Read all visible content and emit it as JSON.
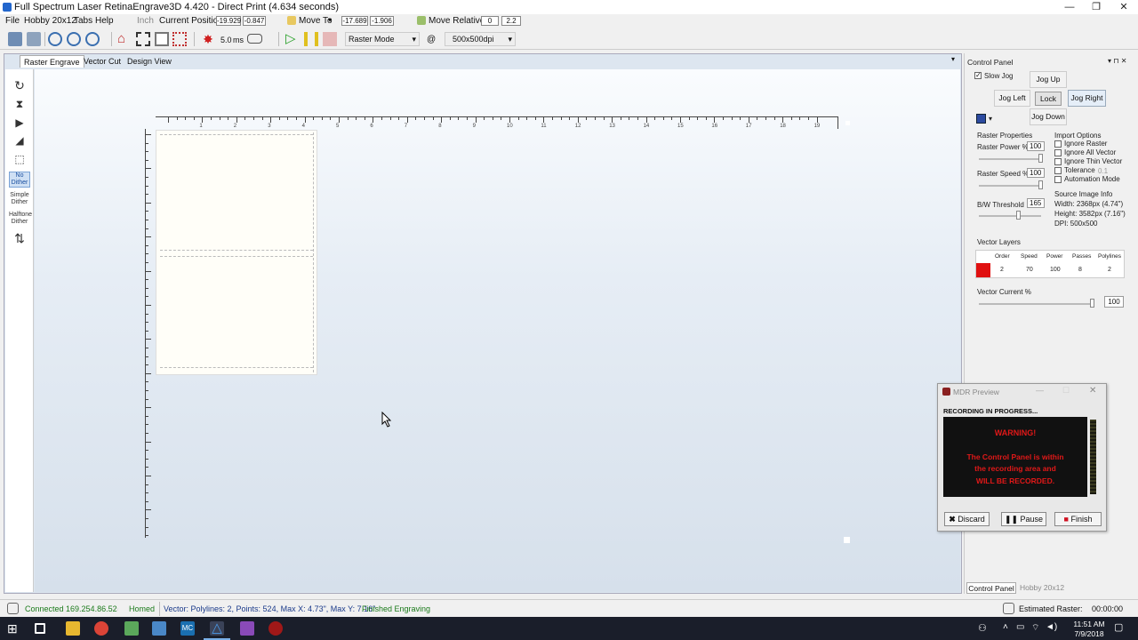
{
  "window": {
    "title": "Full Spectrum Laser RetinaEngrave3D 4.420 - Direct Print (4.634 seconds)"
  },
  "menu": {
    "items": [
      "File",
      "Hobby 20x12",
      "Tabs",
      "Help"
    ],
    "units": "Inch",
    "current_position_label": "Current Position:",
    "pos_x": "-19.929",
    "pos_y": "-0.847",
    "move_to_label": "Move To",
    "move_x": "-17.689",
    "move_y": "-1.906",
    "move_relative_label": "Move Relative",
    "rel_x": "0",
    "rel_y": "2.2"
  },
  "toolbar": {
    "pulse_value": "5.0",
    "pulse_unit": "ms",
    "mode": "Raster Mode",
    "at_symbol": "@",
    "dpi": "500x500dpi"
  },
  "tabs": [
    "Raster Engrave",
    "Vector Cut",
    "Design View"
  ],
  "left_tools": {
    "no_dither": "No Dither",
    "simple_dither": "Simple Dither",
    "halftone_dither": "Halftone Dither"
  },
  "ruler": {
    "h_labels": [
      "1",
      "2",
      "3",
      "4",
      "5",
      "6",
      "7",
      "8",
      "9",
      "10",
      "11",
      "12",
      "13",
      "14",
      "15",
      "16",
      "17",
      "18",
      "19"
    ]
  },
  "control_panel": {
    "title": "Control Panel",
    "slow_jog": "Slow Jog",
    "slow_jog_checked": true,
    "jog_up": "Jog Up",
    "jog_left": "Jog Left",
    "lock": "Lock",
    "jog_right": "Jog Right",
    "jog_down": "Jog Down",
    "raster_properties": "Raster Properties",
    "raster_power_label": "Raster Power %",
    "raster_power": "100",
    "raster_speed_label": "Raster Speed %",
    "raster_speed": "100",
    "bw_threshold_label": "B/W Threshold",
    "bw_threshold": "165",
    "import_options": "Import Options",
    "ignore_raster": "Ignore Raster",
    "ignore_all_vector": "Ignore All Vector",
    "ignore_thin_vector": "Ignore Thin Vector",
    "tolerance": "Tolerance",
    "tolerance_value": "0.1",
    "automation_mode": "Automation Mode",
    "source_image_info": "Source Image Info",
    "width_info": "Width:  2368px (4.74\")",
    "height_info": "Height: 3582px (7.16\")",
    "dpi_info": "DPI: 500x500",
    "vector_layers": "Vector Layers",
    "layer_headers": [
      "Order",
      "Speed",
      "Power",
      "Passes",
      "Polylines"
    ],
    "layer_row": [
      "2",
      "70",
      "100",
      "8",
      "2"
    ],
    "layer_color": "#e01010",
    "vector_current_label": "Vector Current %",
    "vector_current": "100",
    "bottom_tabs": [
      "Control Panel",
      "Hobby 20x12"
    ]
  },
  "mdr": {
    "title": "MDR Preview",
    "recording": "RECORDING IN PROGRESS...",
    "warning": "WARNING!",
    "msg1": "The Control Panel is within",
    "msg2": "the recording area and",
    "msg3": "WILL BE RECORDED.",
    "discard": "Discard",
    "pause": "Pause",
    "finish": "Finish"
  },
  "status": {
    "connected": "Connected 169.254.86.52",
    "homed": "Homed",
    "info": "Vector: Polylines: 2, Points: 524, Max X: 4.73\", Max Y: 7.16\"",
    "finished": "Finished Engraving",
    "estimated_label": "Estimated Raster:",
    "estimated_time": "00:00:00"
  },
  "taskbar": {
    "time": "11:51 AM",
    "date": "7/9/2018"
  }
}
